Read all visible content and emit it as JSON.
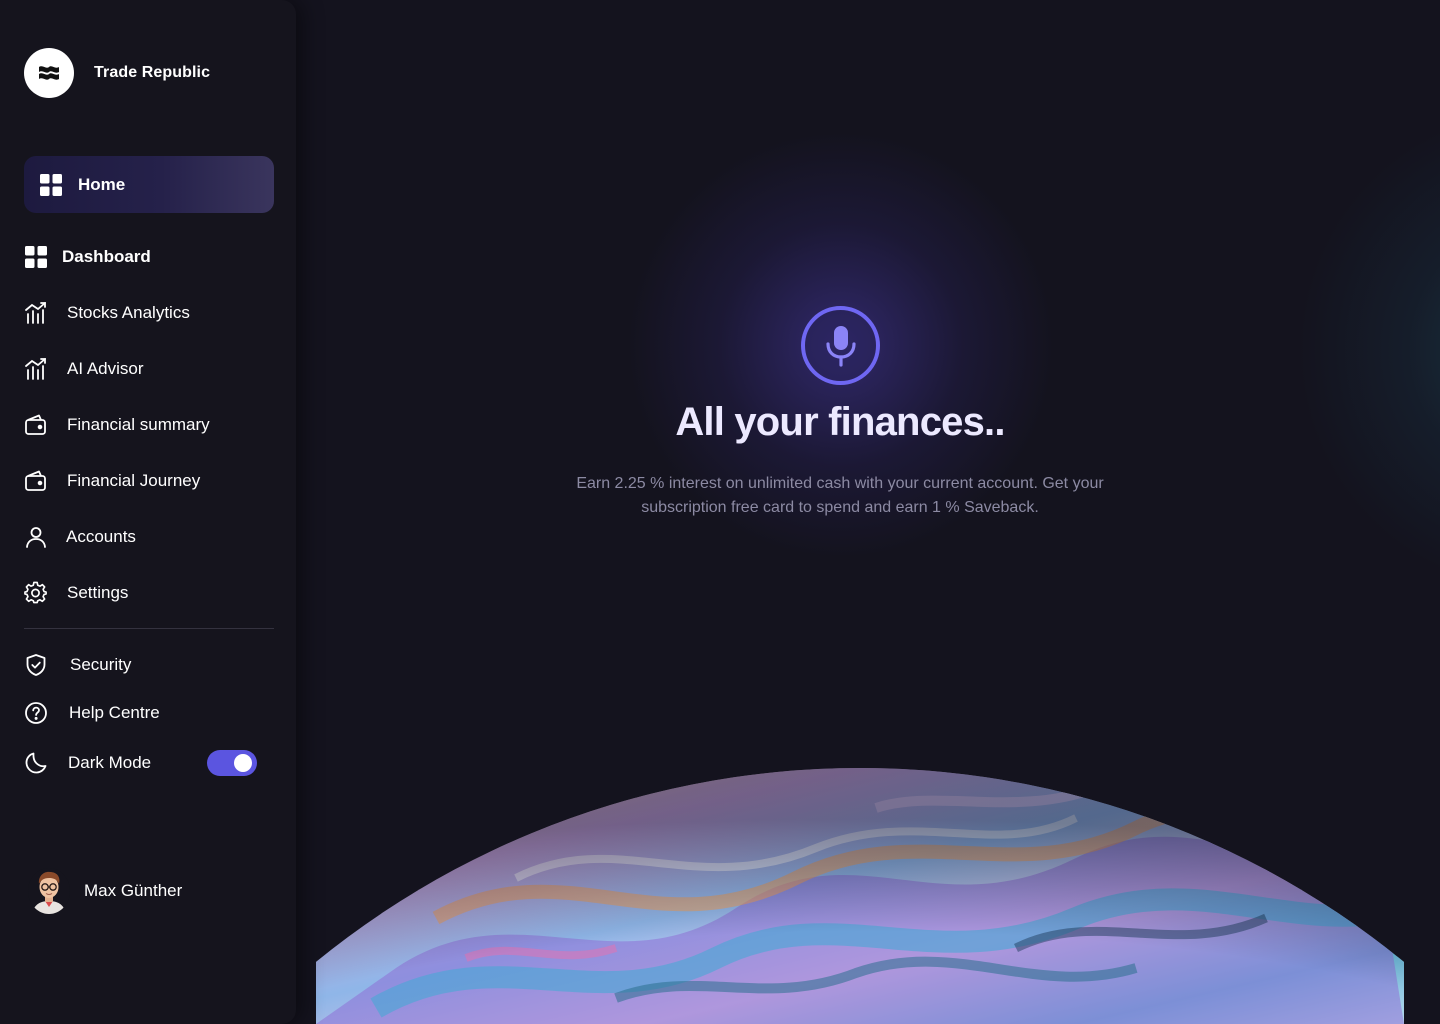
{
  "brand": {
    "name": "Trade Republic",
    "logo_icon": "wave-flag-icon"
  },
  "sidebar": {
    "active": {
      "label": "Home",
      "icon": "grid-icon"
    },
    "items": [
      {
        "label": "Dashboard",
        "icon": "grid-icon"
      },
      {
        "label": "Stocks Analytics",
        "icon": "chart-icon"
      },
      {
        "label": "AI Advisor",
        "icon": "chart-icon"
      },
      {
        "label": "Financial summary",
        "icon": "wallet-icon"
      },
      {
        "label": "Financial Journey",
        "icon": "wallet-icon"
      },
      {
        "label": "Accounts",
        "icon": "user-icon"
      },
      {
        "label": "Settings",
        "icon": "gear-icon"
      }
    ],
    "secondary": [
      {
        "label": "Security",
        "icon": "shield-icon"
      },
      {
        "label": "Help Centre",
        "icon": "help-icon"
      },
      {
        "label": "Dark Mode",
        "icon": "moon-icon",
        "toggle_on": true
      }
    ]
  },
  "user": {
    "name": "Max Günther"
  },
  "hero": {
    "title": "All your finances..",
    "subtitle": "Earn 2.25 % interest on unlimited cash with your current account. Get your subscription free card to spend and earn 1 % Saveback.",
    "mic_icon": "microphone-icon"
  },
  "colors": {
    "background": "#14131e",
    "sidebar": "#15141d",
    "accent": "#5b55e0",
    "mic_ring": "#6f67f2",
    "text_muted": "#8c8aa3"
  }
}
